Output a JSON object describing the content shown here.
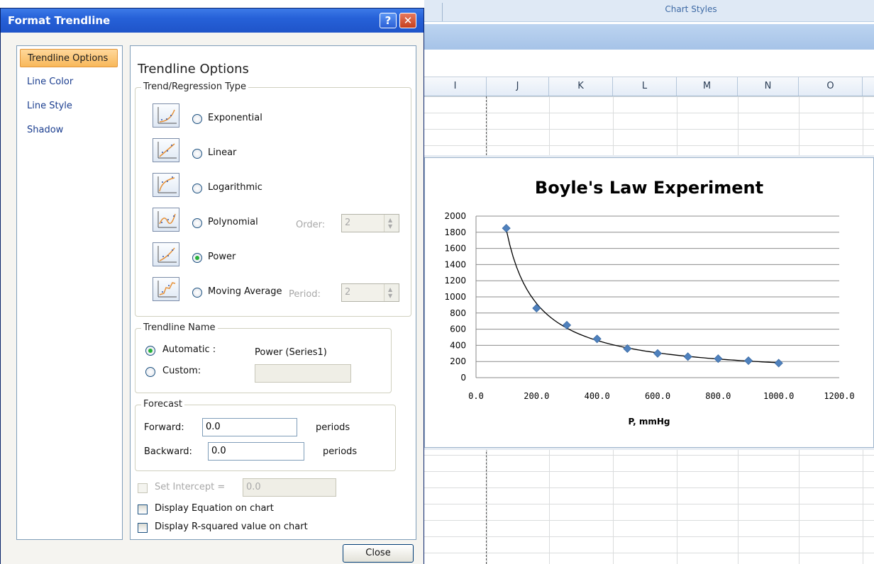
{
  "ribbon": {
    "chart_styles_label": "Chart Styles"
  },
  "columns": [
    "I",
    "J",
    "K",
    "L",
    "M",
    "N",
    "O"
  ],
  "dialog": {
    "title": "Format Trendline",
    "help_icon": "?",
    "close_icon": "✕",
    "nav": [
      "Trendline Options",
      "Line Color",
      "Line Style",
      "Shadow"
    ],
    "pane_title": "Trendline Options",
    "regression_group_label": "Trend/Regression Type",
    "types": [
      {
        "label": "Exponential",
        "icon": "exponential-trend-icon"
      },
      {
        "label": "Linear",
        "icon": "linear-trend-icon"
      },
      {
        "label": "Logarithmic",
        "icon": "logarithmic-trend-icon"
      },
      {
        "label": "Polynomial",
        "icon": "polynomial-trend-icon"
      },
      {
        "label": "Power",
        "icon": "power-trend-icon"
      },
      {
        "label": "Moving Average",
        "icon": "moving-average-icon"
      }
    ],
    "selected_type": "Power",
    "order_label": "Order:",
    "order_value": "2",
    "period_label": "Period:",
    "period_value": "2",
    "name_group_label": "Trendline Name",
    "automatic_label": "Automatic :",
    "automatic_value": "Power (Series1)",
    "custom_label": "Custom:",
    "forecast_group_label": "Forecast",
    "forward_label": "Forward:",
    "forward_value": "0.0",
    "backward_label": "Backward:",
    "backward_value": "0.0",
    "periods_label": "periods",
    "set_intercept_label": "Set Intercept =",
    "set_intercept_value": "0.0",
    "display_equation_label": "Display Equation on chart",
    "display_rsquared_label": "Display R-squared value on chart",
    "close_button_label": "Close"
  },
  "chart_data": {
    "type": "scatter",
    "title": "Boyle's Law Experiment",
    "xlabel": "P, mmHg",
    "ylabel": "",
    "xlim": [
      0,
      1200
    ],
    "ylim": [
      0,
      2000
    ],
    "x_ticks": [
      "0.0",
      "200.0",
      "400.0",
      "600.0",
      "800.0",
      "1000.0",
      "1200.0"
    ],
    "y_ticks": [
      "0",
      "200",
      "400",
      "600",
      "800",
      "1000",
      "1200",
      "1400",
      "1600",
      "1800",
      "2000"
    ],
    "series": [
      {
        "x": [
          100,
          200,
          300,
          400,
          500,
          600,
          700,
          800,
          900,
          1000
        ],
        "y": [
          1850,
          860,
          650,
          480,
          360,
          300,
          260,
          235,
          210,
          180
        ]
      }
    ],
    "trendline": "power",
    "grid": "horizontal",
    "marker_color": "#4f81bd"
  }
}
